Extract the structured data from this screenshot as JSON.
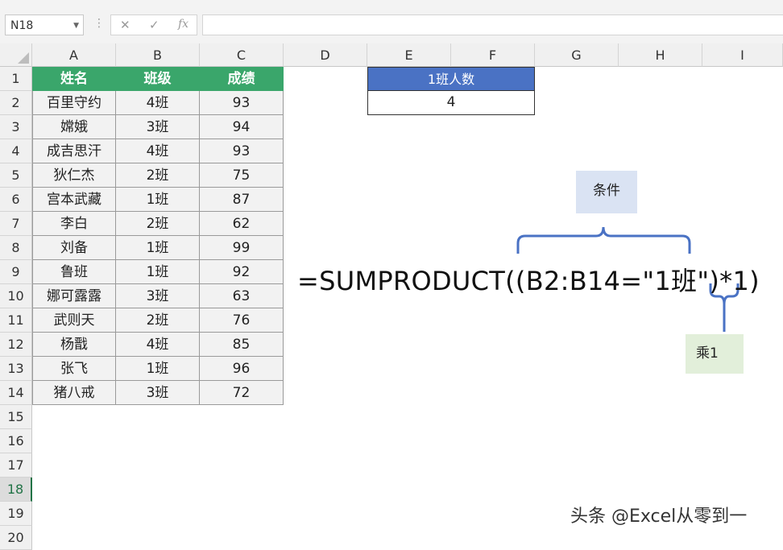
{
  "formula_bar": {
    "name_box": "N18",
    "cancel_icon": "✕",
    "confirm_icon": "✓",
    "fx_icon": "fx",
    "content": ""
  },
  "columns": [
    "A",
    "B",
    "C",
    "D",
    "E",
    "F",
    "G",
    "H",
    "I"
  ],
  "rows": [
    "1",
    "2",
    "3",
    "4",
    "5",
    "6",
    "7",
    "8",
    "9",
    "10",
    "11",
    "12",
    "13",
    "14",
    "15",
    "16",
    "17",
    "18",
    "19",
    "20"
  ],
  "selected_row": "18",
  "table": {
    "headers": [
      "姓名",
      "班级",
      "成绩"
    ],
    "rows": [
      [
        "百里守约",
        "4班",
        "93"
      ],
      [
        "嫦娥",
        "3班",
        "94"
      ],
      [
        "成吉思汗",
        "4班",
        "93"
      ],
      [
        "狄仁杰",
        "2班",
        "75"
      ],
      [
        "宫本武藏",
        "1班",
        "87"
      ],
      [
        "李白",
        "2班",
        "62"
      ],
      [
        "刘备",
        "1班",
        "99"
      ],
      [
        "鲁班",
        "1班",
        "92"
      ],
      [
        "娜可露露",
        "3班",
        "63"
      ],
      [
        "武则天",
        "2班",
        "76"
      ],
      [
        "杨戬",
        "4班",
        "85"
      ],
      [
        "张飞",
        "1班",
        "96"
      ],
      [
        "猪八戒",
        "3班",
        "72"
      ]
    ]
  },
  "summary": {
    "header": "1班人数",
    "value": "4"
  },
  "annotations": {
    "formula": "=SUMPRODUCT((B2:B14=\"1班\")*1)",
    "condition_label": "条件",
    "multiply_label": "乘1"
  },
  "watermark": "头条 @Excel从零到一",
  "colors": {
    "header_green": "#3aa66b",
    "summary_blue": "#4a72c4",
    "brace_blue": "#4a72c4",
    "note_blue": "#dae3f3",
    "note_green": "#e2efda"
  }
}
